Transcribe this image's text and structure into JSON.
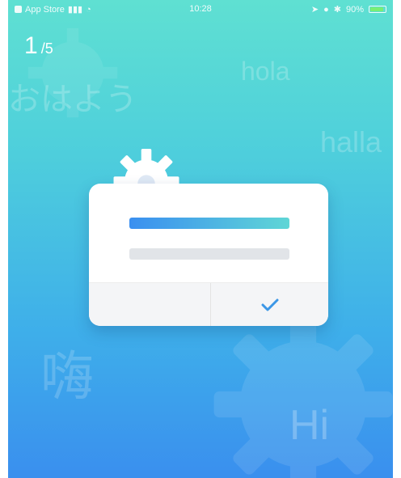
{
  "status_bar": {
    "carrier": "App Store",
    "time": "10:28",
    "battery": "90%",
    "battery_level": 0.9
  },
  "pager": {
    "current": "1",
    "total": "/5"
  },
  "background_words": [
    "おはよう",
    "hola",
    "halla",
    "嗨",
    "Hi"
  ],
  "card": {
    "confirm_icon": "checkmark-icon",
    "illustration_icon": "gear-icon"
  },
  "colors": {
    "gradient_top": "#5fe0d2",
    "gradient_bottom": "#3a8fee",
    "accent_bar_start": "#3a8ff0",
    "accent_bar_end": "#5fd6d6",
    "check_color": "#3c97e6"
  }
}
